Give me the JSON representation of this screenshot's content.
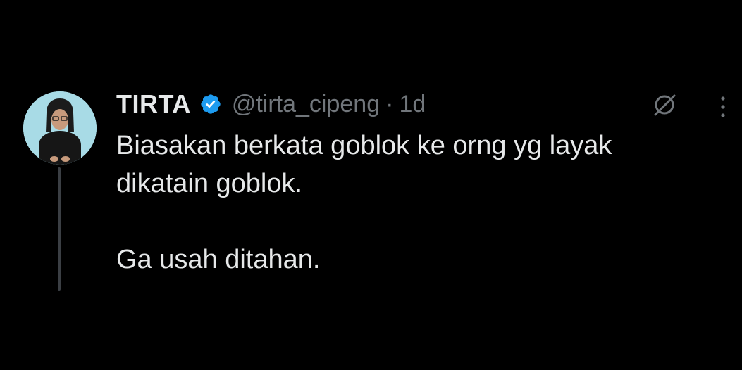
{
  "tweet": {
    "author": {
      "name": "TIRTA",
      "handle": "@tirta_cipeng",
      "verified": true,
      "avatar": "avatar-photo"
    },
    "separator": "·",
    "timestamp": "1d",
    "text_lines": [
      "Biasakan berkata goblok ke orng yg layak",
      "dikatain goblok.",
      "Ga usah ditahan."
    ],
    "icons": {
      "grok": "grok-icon",
      "more": "more-options-icon",
      "verified": "verified-badge-icon"
    },
    "colors": {
      "background": "#000000",
      "text": "#e7e9ea",
      "muted": "#71767b",
      "verified": "#1d9bf0",
      "avatar_bg": "#a8dbe6"
    }
  }
}
